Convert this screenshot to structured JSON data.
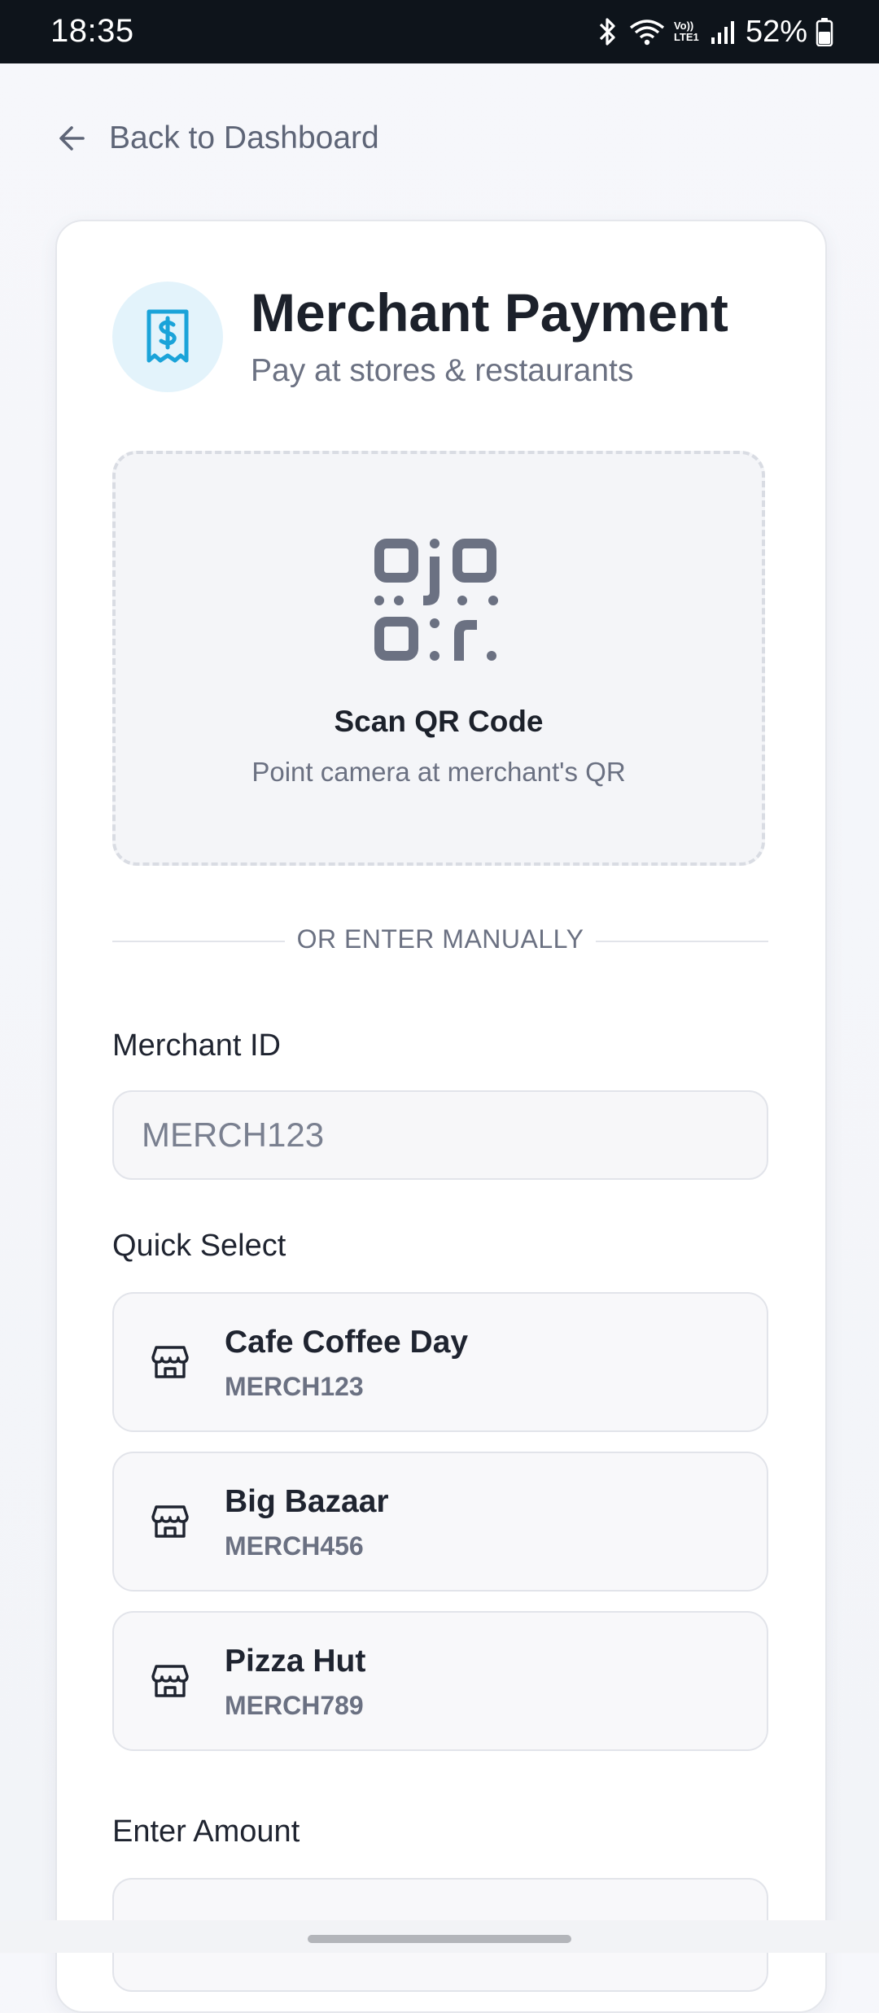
{
  "status_bar": {
    "time": "18:35",
    "volte_label": "Vo)) LTE1",
    "battery": "52%"
  },
  "nav": {
    "back_label": "Back to Dashboard"
  },
  "header": {
    "title": "Merchant Payment",
    "subtitle": "Pay at stores & restaurants",
    "icon": "receipt-dollar-icon",
    "icon_color": "#1aa3d9"
  },
  "scan": {
    "title": "Scan QR Code",
    "subtitle": "Point camera at merchant's QR",
    "icon": "qr-code-icon"
  },
  "divider_text": "OR ENTER MANUALLY",
  "merchant_id": {
    "label": "Merchant ID",
    "placeholder": "MERCH123"
  },
  "quick_select": {
    "label": "Quick Select",
    "items": [
      {
        "name": "Cafe Coffee Day",
        "id": "MERCH123",
        "icon": "store-icon"
      },
      {
        "name": "Big Bazaar",
        "id": "MERCH456",
        "icon": "store-icon"
      },
      {
        "name": "Pizza Hut",
        "id": "MERCH789",
        "icon": "store-icon"
      }
    ]
  },
  "amount": {
    "label": "Enter Amount"
  },
  "colors": {
    "accent": "#1aa3d9",
    "text_primary": "#1f2430",
    "text_secondary": "#6b7182"
  }
}
